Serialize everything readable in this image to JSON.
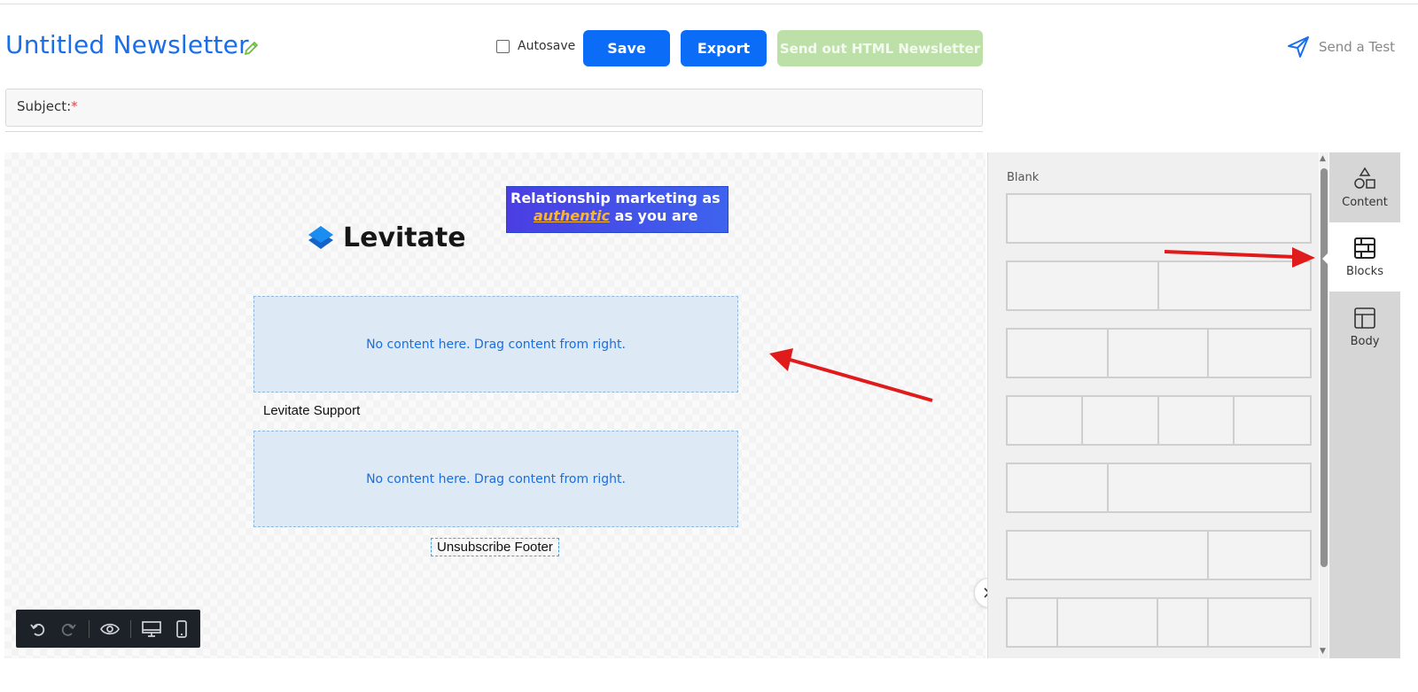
{
  "header": {
    "title": "Untitled Newsletter",
    "autosave_label": "Autosave",
    "save_label": "Save",
    "export_label": "Export",
    "send_label": "Send out HTML Newsletter",
    "send_test_label": "Send a Test"
  },
  "subject": {
    "label": "Subject:",
    "required_mark": "*"
  },
  "canvas": {
    "logo_text": "Levitate",
    "banner_line1": "Relationship marketing as",
    "banner_authentic": "authentic",
    "banner_line2_rest": " as you are",
    "dropzone_text_1": "No content here. Drag content from right.",
    "support_text": "Levitate Support",
    "dropzone_text_2": "No content here. Drag content from right.",
    "unsubscribe_text": "Unsubscribe Footer"
  },
  "panel": {
    "section_label": "Blank",
    "tabs": [
      {
        "label": "Content",
        "icon": "shapes-icon"
      },
      {
        "label": "Blocks",
        "icon": "blocks-icon",
        "active": true
      },
      {
        "label": "Body",
        "icon": "layout-icon"
      }
    ]
  },
  "colors": {
    "primary": "#0b6cf7",
    "send_disabled": "#bde0a8",
    "title": "#1a6ee8",
    "annotation_arrow": "#e01b1b"
  }
}
